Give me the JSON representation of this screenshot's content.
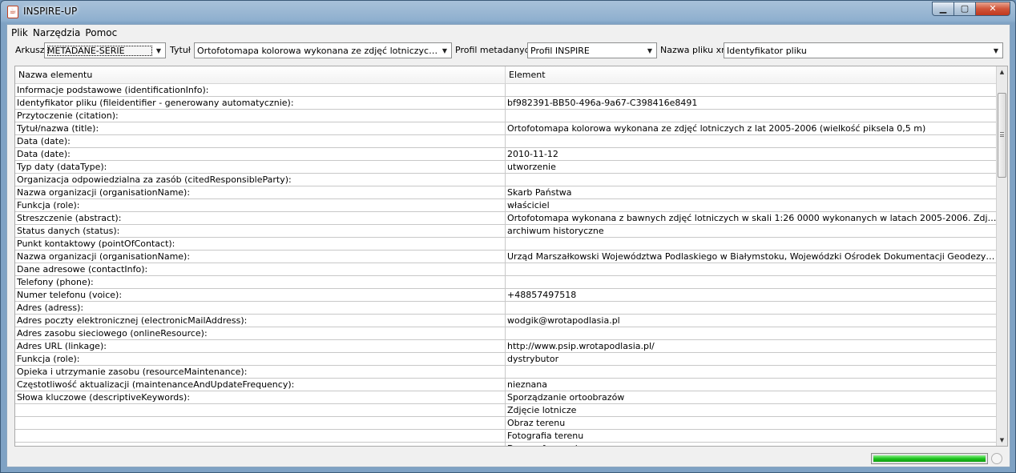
{
  "window": {
    "title": "INSPIRE-UP",
    "minimize_glyph": "▁",
    "maximize_glyph": "▢",
    "close_glyph": "✕"
  },
  "menu": [
    "Plik",
    "Narzędzia",
    "Pomoc"
  ],
  "toolbar": {
    "arkusz_label": "Arkusz",
    "arkusz_value": "METADANE-SERIE",
    "tytul_label": "Tytuł",
    "tytul_value": "Ortofotomapa kolorowa wykonana ze zdjęć lotniczych z lat 2005-2006 (wielkość piksela 0,5 m)",
    "profil_label": "Profil metadanych",
    "profil_value": "Profil INSPIRE",
    "nazwa_label": "Nazwa pliku xml",
    "nazwa_value": "Identyfikator pliku"
  },
  "table": {
    "columns": [
      "Nazwa elementu",
      "Element"
    ],
    "rows": [
      [
        "Informacje podstawowe (identificationInfo):",
        ""
      ],
      [
        "Identyfikator pliku (fileidentifier - generowany automatycznie):",
        "bf982391-BB50-496a-9a67-C398416e8491"
      ],
      [
        "Przytoczenie (citation):",
        ""
      ],
      [
        "Tytuł/nazwa (title):",
        "Ortofotomapa kolorowa wykonana ze zdjęć lotniczych z lat 2005-2006 (wielkość piksela 0,5 m)"
      ],
      [
        "Data (date):",
        ""
      ],
      [
        "Data (date):",
        "2010-11-12"
      ],
      [
        "Typ daty (dataType):",
        "utworzenie"
      ],
      [
        "Organizacja odpowiedzialna za zasób (citedResponsibleParty):",
        ""
      ],
      [
        "Nazwa organizacji (organisationName):",
        "Skarb Państwa"
      ],
      [
        "Funkcja (role):",
        "właściciel"
      ],
      [
        "Streszczenie (abstract):",
        "Ortofotomapa wykonana z bawnych zdjęć lotniczych w skali 1:26 0000 wykonanych w latach 2005-2006. Zdjęcia zostały po..."
      ],
      [
        "Status danych (status):",
        "archiwum historyczne"
      ],
      [
        "Punkt kontaktowy (pointOfContact):",
        ""
      ],
      [
        "Nazwa organizacji (organisationName):",
        "Urząd Marszałkowski Województwa Podlaskiego w Białymstoku, Wojewódzki Ośrodek Dokumentacji Geodezyjnej i Kartografi..."
      ],
      [
        "Dane adresowe (contactInfo):",
        ""
      ],
      [
        "Telefony (phone):",
        ""
      ],
      [
        "Numer telefonu (voice):",
        "+48857497518"
      ],
      [
        "Adres (adress):",
        ""
      ],
      [
        "Adres poczty elektronicznej (electronicMailAddress):",
        "wodgik@wrotapodlasia.pl"
      ],
      [
        "Adres zasobu sieciowego (onlineResource):",
        ""
      ],
      [
        "Adres URL (linkage):",
        "http://www.psip.wrotapodlasia.pl/"
      ],
      [
        "Funkcja (role):",
        "dystrybutor"
      ],
      [
        "Opieka i utrzymanie zasobu (resourceMaintenance):",
        ""
      ],
      [
        "Częstotliwość aktualizacji (maintenanceAndUpdateFrequency):",
        "nieznana"
      ],
      [
        "Słowa kluczowe (descriptiveKeywords):",
        "Sporządzanie ortoobrazów"
      ],
      [
        "",
        "Zdjęcie lotnicze"
      ],
      [
        "",
        "Obraz terenu"
      ],
      [
        "",
        "Fotografia terenu"
      ],
      [
        "",
        "Dane referencyjne"
      ]
    ]
  },
  "scroll_position": 0.05,
  "progress": 1.0,
  "colors": {
    "progress_fill": "#1ec21e",
    "titlebar": "#8fb0cf",
    "close_button": "#c0381e"
  }
}
